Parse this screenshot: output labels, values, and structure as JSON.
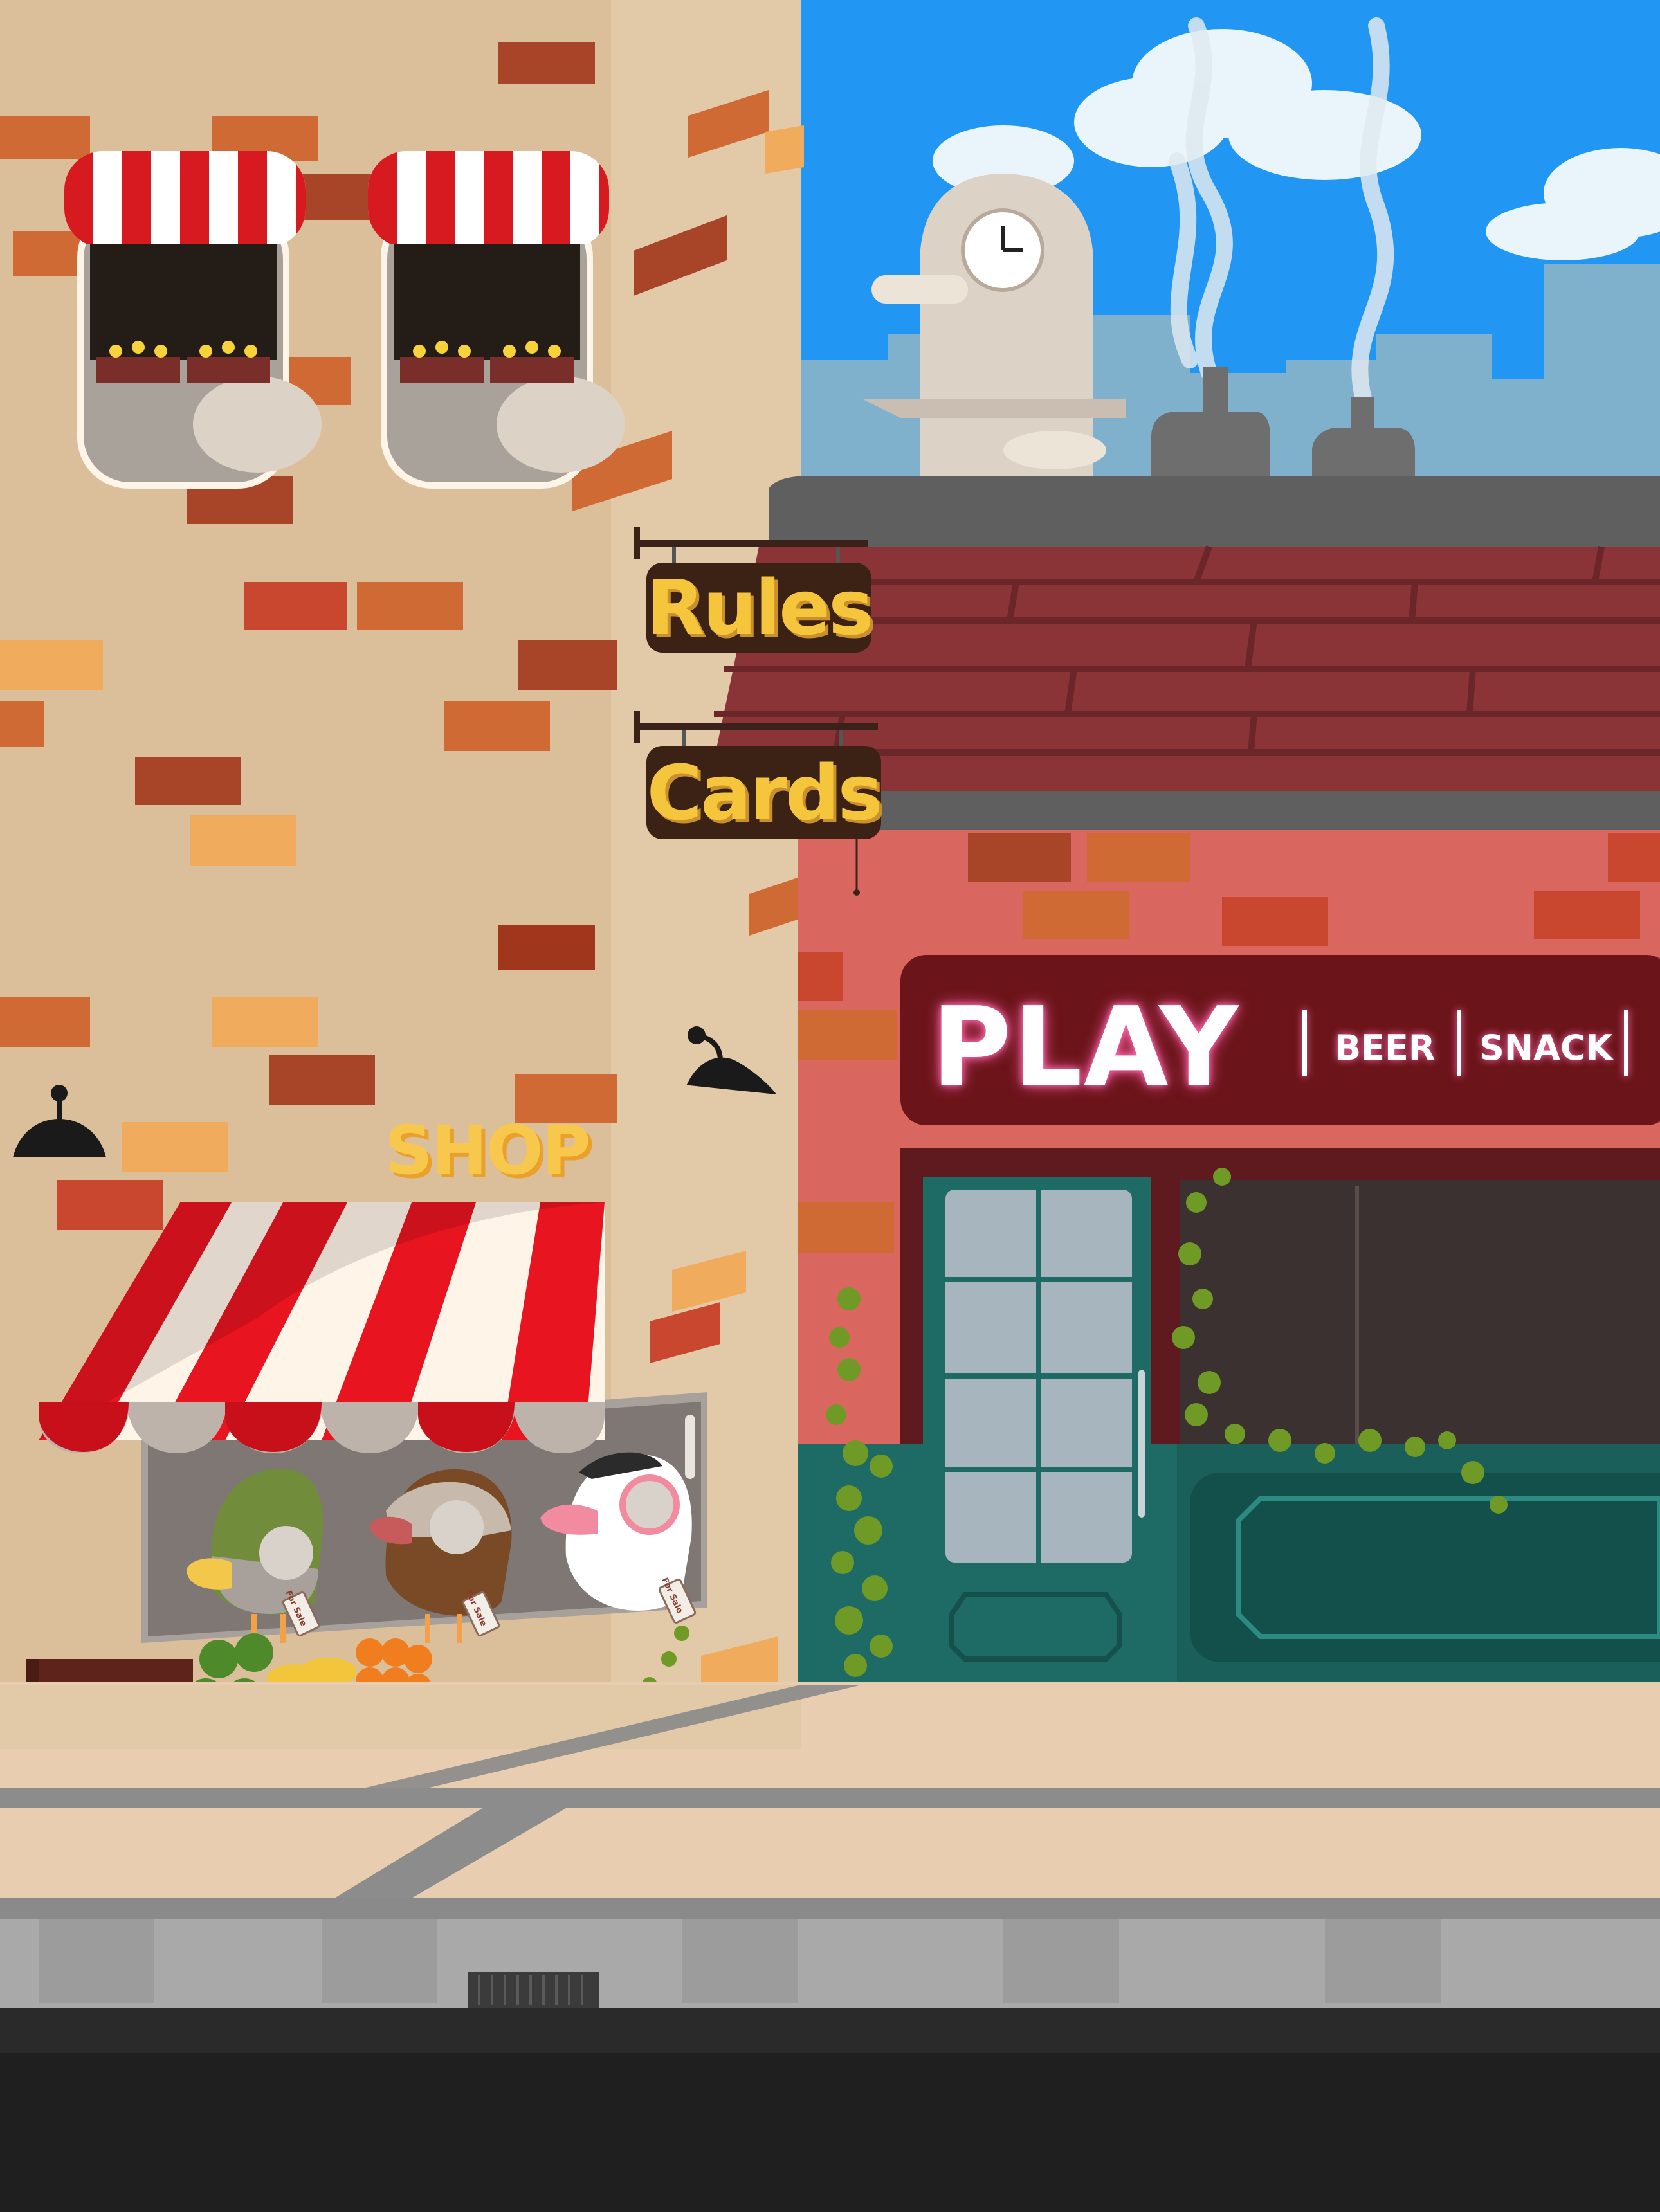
{
  "signs": {
    "rules": "Rules",
    "cards": "Cards"
  },
  "bar": {
    "play": "PLAY",
    "menu": [
      "BEER",
      "SNACK"
    ]
  },
  "shop": {
    "label": "SHOP",
    "tags": [
      "For Sale",
      "For Sale",
      "For Sale"
    ]
  },
  "colors": {
    "sky": "#2196f3",
    "bar_sign": "#6b1419",
    "pub_wall": "#d9665f",
    "door": "#1e6b66",
    "awning_red": "#e8141f",
    "sign_text": "#f5c53c"
  }
}
